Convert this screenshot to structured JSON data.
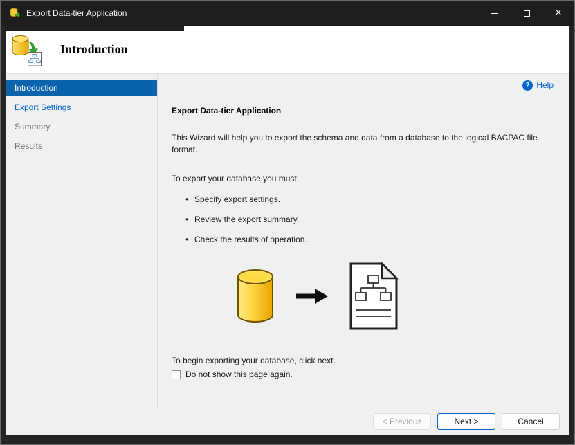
{
  "window": {
    "title": "Export Data-tier Application"
  },
  "banner": {
    "title": "Introduction"
  },
  "sidebar": {
    "items": [
      {
        "label": "Introduction",
        "state": "selected"
      },
      {
        "label": "Export Settings",
        "state": "enabled"
      },
      {
        "label": "Summary",
        "state": "pending"
      },
      {
        "label": "Results",
        "state": "pending"
      }
    ]
  },
  "content": {
    "help_label": "Help",
    "help_icon": "?",
    "heading": "Export Data-tier Application",
    "intro": "This Wizard will help you to export the schema and data from a database to the logical BACPAC file format.",
    "requirements_intro": "To export your database you must:",
    "bullets": [
      "Specify export settings.",
      "Review the export summary.",
      "Check the results of operation."
    ],
    "next_note": "To begin exporting your database, click next.",
    "checkbox_label": "Do not show this page again.",
    "checkbox_checked": false
  },
  "buttons": {
    "previous": "< Previous",
    "next": "Next >",
    "cancel": "Cancel"
  },
  "colors": {
    "accent": "#0a64ad",
    "link": "#0066cc",
    "titlebar": "#1e1e1e",
    "next_border": "#0067c0"
  }
}
